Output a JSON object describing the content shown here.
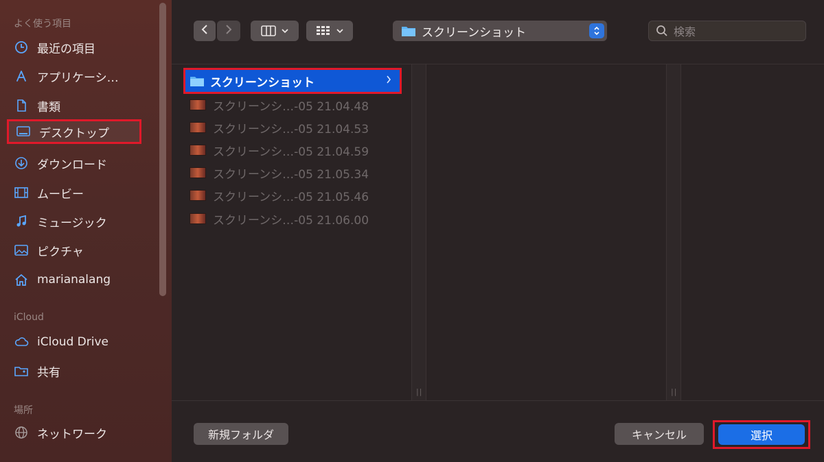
{
  "sidebar": {
    "favorites_title": "よく使う項目",
    "items": [
      {
        "label": "最近の項目",
        "icon": "clock-icon"
      },
      {
        "label": "アプリケーシ…",
        "icon": "apps-icon"
      },
      {
        "label": "書類",
        "icon": "document-icon"
      },
      {
        "label": "デスクトップ",
        "icon": "desktop-icon"
      },
      {
        "label": "ダウンロード",
        "icon": "download-icon"
      },
      {
        "label": "ムービー",
        "icon": "film-icon"
      },
      {
        "label": "ミュージック",
        "icon": "music-icon"
      },
      {
        "label": "ピクチャ",
        "icon": "picture-icon"
      },
      {
        "label": "marianalang",
        "icon": "home-icon"
      }
    ],
    "icloud_title": "iCloud",
    "icloud_items": [
      {
        "label": "iCloud Drive",
        "icon": "cloud-icon"
      },
      {
        "label": "共有",
        "icon": "shared-folder-icon"
      }
    ],
    "locations_title": "場所",
    "location_items": [
      {
        "label": "ネットワーク",
        "icon": "globe-icon"
      }
    ]
  },
  "toolbar": {
    "current_folder": "スクリーンショット",
    "search_placeholder": "検索"
  },
  "browser": {
    "selected_folder": "スクリーンショット",
    "files": [
      "スクリーンシ…-05 21.04.48",
      "スクリーンシ…-05 21.04.53",
      "スクリーンシ…-05 21.04.59",
      "スクリーンシ…-05 21.05.34",
      "スクリーンシ…-05 21.05.46",
      "スクリーンシ…-05 21.06.00"
    ]
  },
  "footer": {
    "new_folder": "新規フォルダ",
    "cancel": "キャンセル",
    "choose": "選択"
  },
  "colors": {
    "accent": "#1b6ee6",
    "highlight_box": "#e0192a",
    "sidebar_icon": "#5aa7ff"
  }
}
